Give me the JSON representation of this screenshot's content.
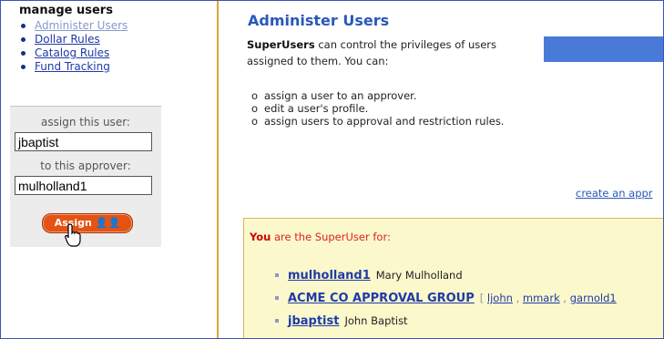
{
  "sidebar": {
    "heading": "manage users",
    "items": [
      {
        "label": "Administer Users"
      },
      {
        "label": "Dollar Rules"
      },
      {
        "label": "Catalog Rules"
      },
      {
        "label": "Fund Tracking"
      }
    ],
    "assign": {
      "user_label": "assign this user:",
      "user_value": "jbaptist",
      "approver_label": "to this approver:",
      "approver_value": "mulholland1",
      "button_label": "Assign"
    }
  },
  "main": {
    "title": "Administer Users",
    "intro_bold": "SuperUsers",
    "intro_rest": " can control the privileges of users assigned to them. You can:",
    "bullets": [
      "assign a user to an approver.",
      "edit a user's profile.",
      "assign users to approval and restriction rules."
    ],
    "create_link": "create an appr",
    "superuser": {
      "you": "You",
      "text": " are the SuperUser for:",
      "entries": [
        {
          "username": "mulholland1",
          "fullname": "Mary Mulholland"
        },
        {
          "username": "ACME CO APPROVAL GROUP",
          "members": [
            "ljohn",
            "mmark",
            "garnold1"
          ]
        },
        {
          "username": "jbaptist",
          "fullname": "John Baptist"
        }
      ]
    }
  },
  "colors": {
    "accent": "#2a58b8",
    "button": "#e45314",
    "divider": "#d9a43a",
    "panel_yellow": "#fbf8cc"
  }
}
